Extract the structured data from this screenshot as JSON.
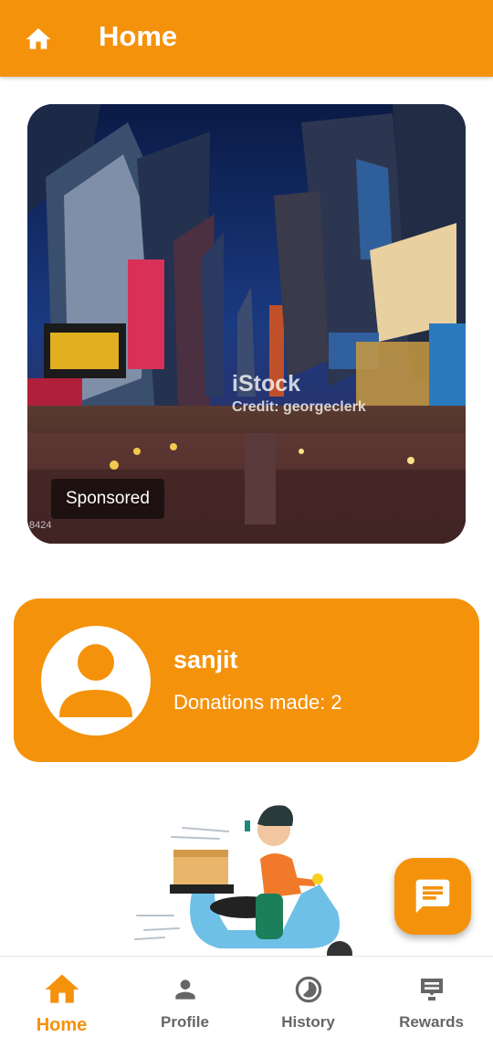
{
  "app_bar": {
    "title": "Home",
    "icon": "home-icon"
  },
  "ad_card": {
    "badge": "Sponsored",
    "watermark_brand": "iStock",
    "watermark_credit": "Credit: georgeclerk",
    "stock_id": "8424"
  },
  "profile": {
    "name": "sanjit",
    "donations_text": "Donations made: 2"
  },
  "fab": {
    "icon": "chat-icon"
  },
  "bottom_nav": {
    "items": [
      {
        "label": "Home",
        "icon": "home-icon",
        "active": true
      },
      {
        "label": "Profile",
        "icon": "person-icon",
        "active": false
      },
      {
        "label": "History",
        "icon": "history-icon",
        "active": false
      },
      {
        "label": "Rewards",
        "icon": "rewards-icon",
        "active": false
      }
    ]
  },
  "colors": {
    "accent": "#f5920b",
    "inactive": "#666666",
    "background": "#ffffff"
  }
}
